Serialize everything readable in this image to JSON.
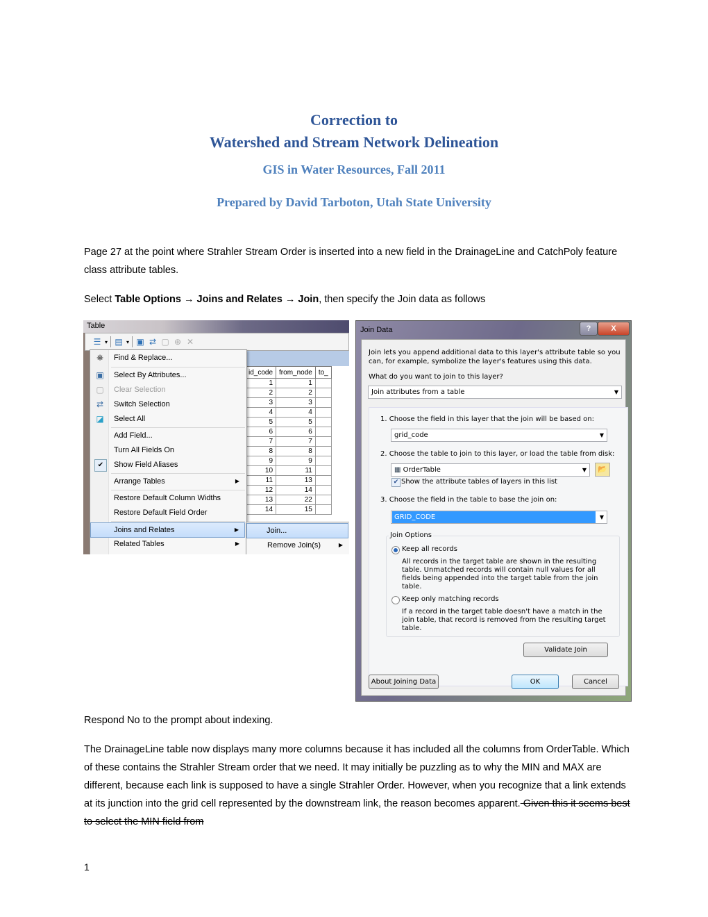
{
  "header": {
    "title_line1": "Correction to",
    "title_line2": "Watershed and Stream Network Delineation",
    "course": "GIS in Water Resources, Fall 2011",
    "author": "Prepared by David Tarboton, Utah State University"
  },
  "body": {
    "para1": "Page 27 at the point where Strahler Stream Order is inserted into a new field in the DrainageLine and CatchPoly feature class attribute tables.",
    "para2_prefix": "Select ",
    "para2_b1": "Table Options",
    "para2_arrow": "→",
    "para2_b2": "Joins and Relates",
    "para2_b3": "Join",
    "para2_suffix": ", then specify the Join data as follows",
    "para3": "Respond No to the prompt about indexing.",
    "para4_main": "The DrainageLine table now displays many more columns because it has included all the columns from OrderTable.  Which of these contains the Strahler Stream order that we need.  It may initially be puzzling as to why the MIN and MAX are different, because each link is supposed to have a single Strahler Order.  However, when you recognize that a link extends at its junction into the grid cell represented by the downstream link, the reason becomes apparent.",
    "para4_struck": "  Given this it seems best to select the MIN field from",
    "page_number": "1"
  },
  "table_window": {
    "title": "Table",
    "columns": [
      "id_code",
      "from_node",
      "to_"
    ],
    "rows": [
      [
        1,
        1
      ],
      [
        2,
        2
      ],
      [
        3,
        3
      ],
      [
        4,
        4
      ],
      [
        5,
        5
      ],
      [
        6,
        6
      ],
      [
        7,
        7
      ],
      [
        8,
        8
      ],
      [
        9,
        9
      ],
      [
        10,
        11
      ],
      [
        11,
        13
      ],
      [
        12,
        14
      ],
      [
        13,
        22
      ],
      [
        14,
        15
      ]
    ],
    "menu": [
      {
        "label": "Find & Replace...",
        "icon": "binoculars-icon"
      },
      {
        "label": "Select By Attributes...",
        "icon": "select-attributes-icon"
      },
      {
        "label": "Clear Selection",
        "icon": "clear-selection-icon",
        "disabled": true
      },
      {
        "label": "Switch Selection",
        "icon": "switch-selection-icon"
      },
      {
        "label": "Select All",
        "icon": "select-all-icon"
      },
      {
        "label": "Add Field..."
      },
      {
        "label": "Turn All Fields On"
      },
      {
        "label": "Show Field Aliases",
        "checked": true
      },
      {
        "label": "Arrange Tables",
        "submenu": true
      },
      {
        "label": "Restore Default Column Widths"
      },
      {
        "label": "Restore Default Field Order"
      },
      {
        "label": "Joins and Relates",
        "submenu": true,
        "highlighted": true
      },
      {
        "label": "Related Tables",
        "submenu": true
      }
    ],
    "submenu": [
      {
        "label": "Join...",
        "highlighted": true
      },
      {
        "label": "Remove Join(s)",
        "submenu": true
      }
    ]
  },
  "join_dialog": {
    "title": "Join Data",
    "help_label": "?",
    "close_label": "X",
    "intro": "Join lets you append additional data to this layer's attribute table so you can, for example, symbolize the layer's features using this data.",
    "question": "What do you want to join to this layer?",
    "join_type": "Join attributes from a table",
    "step1_label": "1.  Choose the field in this layer that the join will be based on:",
    "step1_value": "grid_code",
    "step2_label": "2.  Choose the table to join to this layer, or load the table from disk:",
    "step2_value": "OrderTable",
    "show_tables_label": "Show the attribute tables of layers in this list",
    "show_tables_checked": true,
    "step3_label": "3.  Choose the field in the table to base the join on:",
    "step3_value": "GRID_CODE",
    "options_title": "Join Options",
    "opt1_label": "Keep all records",
    "opt1_selected": true,
    "opt1_desc": "All records in the target table are shown in the resulting table. Unmatched records will contain null values for all fields being appended into the target table from the join table.",
    "opt2_label": "Keep only matching records",
    "opt2_selected": false,
    "opt2_desc": "If a record in the target table doesn't have a match in the join table, that record is removed from the resulting target table.",
    "validate_label": "Validate Join",
    "about_label": "About Joining Data",
    "ok_label": "OK",
    "cancel_label": "Cancel"
  }
}
